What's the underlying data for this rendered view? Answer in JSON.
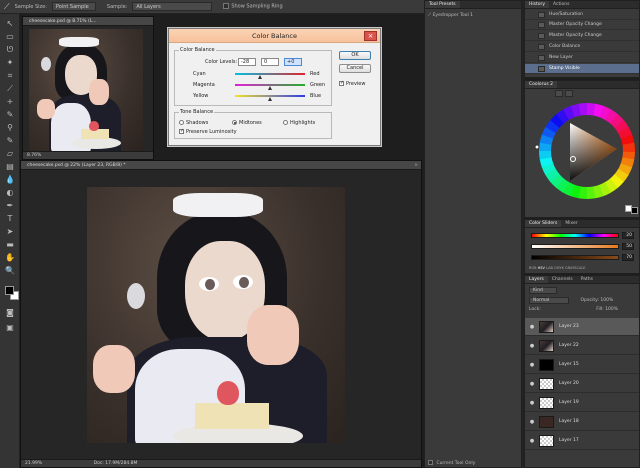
{
  "options_bar": {
    "sample_size_label": "Sample Size:",
    "sample_size_value": "Point Sample",
    "sample_label": "Sample:",
    "sample_value": "All Layers",
    "show_ring_label": "Show Sampling Ring"
  },
  "small_doc": {
    "tab_title": "cheesecake.psd @ 8.71% (L...",
    "zoom": "8.76%"
  },
  "main_doc": {
    "tab_title": "cheesecake.psd @ 22% (Layer 23, RGB/8) *",
    "zoom": "21.99%",
    "doc_size": "Doc: 17.9M/284.8M"
  },
  "color_balance": {
    "title": "Color Balance",
    "close_glyph": "×",
    "group_color_balance": "Color Balance",
    "color_levels_label": "Color Levels:",
    "levels": [
      "-28",
      "0",
      "+0"
    ],
    "sliders": [
      {
        "left": "Cyan",
        "right": "Red",
        "value": -28,
        "gradient": [
          "#00bfe6",
          "#e3232b"
        ]
      },
      {
        "left": "Magenta",
        "right": "Green",
        "value": 0,
        "gradient": [
          "#e020d8",
          "#24b02c"
        ]
      },
      {
        "left": "Yellow",
        "right": "Blue",
        "value": 0,
        "gradient": [
          "#f0e030",
          "#2c3ce8"
        ]
      }
    ],
    "group_tone_balance": "Tone Balance",
    "tones": [
      "Shadows",
      "Midtones",
      "Highlights"
    ],
    "selected_tone": "Midtones",
    "preserve_luminosity": "Preserve Luminosity",
    "check_glyph": "✓",
    "ok": "OK",
    "cancel": "Cancel",
    "preview": "Preview"
  },
  "tool_presets": {
    "tab": "Tool Presets",
    "item": "Eyedropper Tool 1",
    "current_tool_only": "Current Tool Only"
  },
  "history": {
    "tabs": [
      "History",
      "Actions"
    ],
    "items": [
      "Hue/Saturation",
      "Master Opacity Change",
      "Master Opacity Change",
      "Color Balance",
      "New Layer",
      "Stamp Visible"
    ],
    "selected_index": 5
  },
  "coolorus": {
    "tab": "Coolorus 2"
  },
  "color_sliders": {
    "tabs": [
      "Color Sliders",
      "Mixer"
    ],
    "values": [
      "20",
      "50",
      "70"
    ],
    "modes": [
      "RGB",
      "HSV",
      "LAB",
      "CMYK",
      "GRAYSCALE"
    ]
  },
  "layers": {
    "tabs": [
      "Layers",
      "Channels",
      "Paths"
    ],
    "kind_label": "Kind",
    "blend_mode": "Normal",
    "opacity_label": "Opacity:",
    "opacity_value": "100%",
    "lock_label": "Lock:",
    "fill_label": "Fill:",
    "fill_value": "100%",
    "eye_glyph": "●",
    "items": [
      {
        "name": "Layer 23",
        "thumb": "art",
        "selected": true
      },
      {
        "name": "Layer 22",
        "thumb": "art",
        "selected": false
      },
      {
        "name": "Layer 15",
        "thumb": "black",
        "selected": false
      },
      {
        "name": "Layer 20",
        "thumb": "checker",
        "selected": false
      },
      {
        "name": "Layer 19",
        "thumb": "checker",
        "selected": false
      },
      {
        "name": "Layer 18",
        "thumb": "brown",
        "selected": false
      },
      {
        "name": "Layer 17",
        "thumb": "checker",
        "selected": false
      }
    ]
  },
  "icons": {
    "eyedropper": "⟋",
    "plus": "+",
    "arrow": "↖",
    "marquee": "▭",
    "lasso": "ᘎ",
    "wand": "✦",
    "crop": "⌗",
    "brush": "✎",
    "stamp": "⚲",
    "eraser": "▱",
    "gradient": "▤",
    "drop": "💧",
    "dodge": "◐",
    "pen": "✒",
    "type": "T",
    "path": "➤",
    "shape": "▬",
    "hand": "✋",
    "zoom": "🔍",
    "mask": "◙",
    "screen": "▣"
  },
  "colors": {
    "foreground": "#000000",
    "background": "#ffffff",
    "dialog_title": "#f7c29c"
  }
}
